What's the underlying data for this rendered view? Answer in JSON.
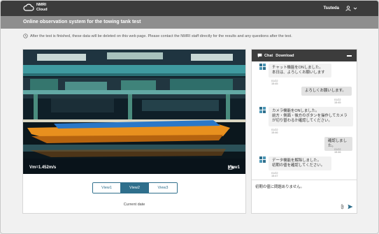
{
  "header": {
    "logo_line1": "NMRI",
    "logo_line2": "Cloud",
    "user_name": "Tsuteda"
  },
  "page": {
    "title": "Online observation system for the towing tank test",
    "notice": "After the test is finished, these data will be deleted on this web page. Please contact the NMRI staff directly for the results and any questions after the test."
  },
  "video": {
    "speed": "Vm=1.452m/s",
    "view_label": "View1",
    "tabs": [
      "View1",
      "View2",
      "View3"
    ],
    "active_tab": "View2",
    "current_date": "Current date"
  },
  "chat": {
    "header": "Chat",
    "download": "Download",
    "messages": [
      {
        "from": "bot",
        "lines": [
          "チャット機能をONしました。",
          "本日は、よろしくお願いします"
        ],
        "time": "01/22 15:45"
      },
      {
        "from": "me",
        "lines": [
          "よろしくお願いします。"
        ],
        "time": "01/22 15:45"
      },
      {
        "from": "bot",
        "lines": [
          "カメラ機能をONしました。",
          "前方・側面・後方のボタンを操作してカメラ",
          "が切り替わるか確認してください。"
        ],
        "time": "01/22 15:46"
      },
      {
        "from": "me",
        "lines": [
          "確認しました。"
        ],
        "time": "01/22 15:46"
      },
      {
        "from": "bot",
        "lines": [
          "データ機能を解除しました。",
          "初期の値を確認してください。"
        ],
        "time": "01/22 15:47"
      }
    ],
    "input_value": "初期の値に問題ありません。",
    "colors": {
      "header_bg": "#3c3c3c",
      "accent": "#2f6f8c"
    }
  }
}
